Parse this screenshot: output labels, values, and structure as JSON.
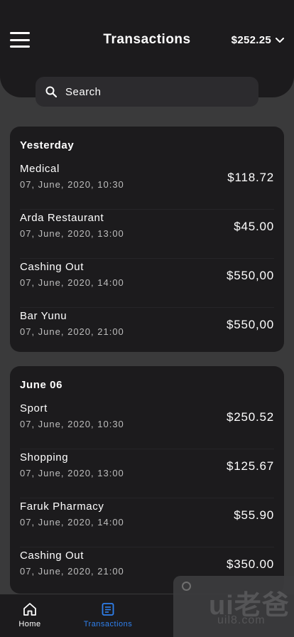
{
  "header": {
    "title": "Transactions",
    "balance": "$252.25"
  },
  "search": {
    "placeholder": "Search"
  },
  "groups": [
    {
      "title": "Yesterday",
      "items": [
        {
          "name": "Medical",
          "date": "07, June, 2020, 10:30",
          "amount": "$118.72"
        },
        {
          "name": "Arda Restaurant",
          "date": "07, June, 2020, 13:00",
          "amount": "$45.00"
        },
        {
          "name": "Cashing Out",
          "date": "07, June, 2020, 14:00",
          "amount": "$550,00"
        },
        {
          "name": "Bar Yunu",
          "date": "07, June, 2020, 21:00",
          "amount": "$550,00"
        }
      ]
    },
    {
      "title": "June 06",
      "items": [
        {
          "name": "Sport",
          "date": "07, June, 2020, 10:30",
          "amount": "$250.52"
        },
        {
          "name": "Shopping",
          "date": "07, June, 2020, 13:00",
          "amount": "$125.67"
        },
        {
          "name": "Faruk Pharmacy",
          "date": "07, June, 2020, 14:00",
          "amount": "$55.90"
        },
        {
          "name": "Cashing Out",
          "date": "07, June, 2020, 21:00",
          "amount": "$350.00"
        }
      ]
    }
  ],
  "tabbar": {
    "home": "Home",
    "transactions": "Transactions",
    "active_color": "#2f80ed"
  },
  "watermark": {
    "logo": "ui老爸",
    "url": "uil8.com"
  }
}
